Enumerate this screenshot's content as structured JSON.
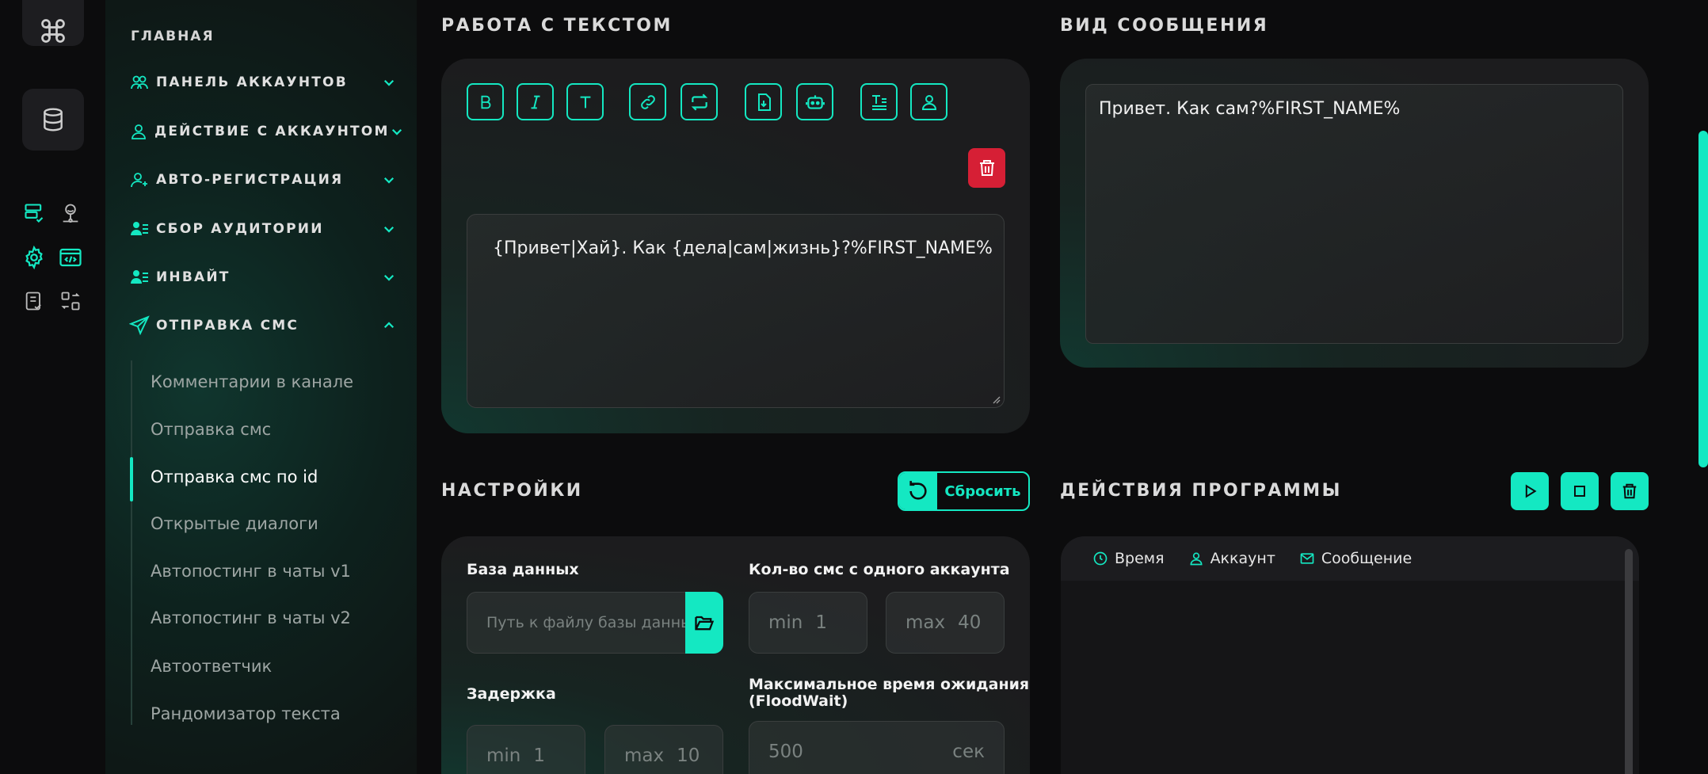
{
  "sidebar": {
    "home": "ГЛАВНАЯ",
    "sections": [
      {
        "label": "ПАНЕЛЬ АККАУНТОВ"
      },
      {
        "label": "ДЕЙСТВИЕ С АККАУНТОМ"
      },
      {
        "label": "АВТО-РЕГИСТРАЦИЯ"
      },
      {
        "label": "СБОР АУДИТОРИИ"
      },
      {
        "label": "ИНВАЙТ"
      },
      {
        "label": "ОТПРАВКА СМС"
      }
    ],
    "sub_items": [
      {
        "label": "Комментарии в канале"
      },
      {
        "label": "Отправка смс"
      },
      {
        "label": "Отправка смс по id"
      },
      {
        "label": "Открытые диалоги"
      },
      {
        "label": "Автопостинг в чаты v1"
      },
      {
        "label": "Автопостинг в чаты v2"
      },
      {
        "label": "Автоответчик"
      },
      {
        "label": "Рандомизатор текста"
      }
    ],
    "active_sub": "Отправка смс по id"
  },
  "text_work": {
    "title": "РАБОТА С ТЕКСТОМ",
    "toolbar": [
      "bold-icon",
      "italic-icon",
      "text-icon",
      "link-icon",
      "repeat-icon",
      "file-import-icon",
      "bot-icon",
      "text-format-icon",
      "user-icon"
    ],
    "content": "{Привет|Хай}. Как {дела|сам|жизнь}?%FIRST_NAME%"
  },
  "preview": {
    "title": "ВИД СООБЩЕНИЯ",
    "text": "Привет. Как сам?%FIRST_NAME%"
  },
  "settings": {
    "title": "НАСТРОЙКИ",
    "reset_label": "Сбросить",
    "database_label": "База данных",
    "database_placeholder": "Путь к файлу базы данных",
    "sms_per_account_label": "Кол-во смс с одного аккаунта",
    "sms_min_label": "min",
    "sms_min_value": "1",
    "sms_max_label": "max",
    "sms_max_value": "40",
    "delay_label": "Задержка",
    "delay_min_label": "min",
    "delay_min_value": "1",
    "delay_max_label": "max",
    "delay_max_value": "10",
    "floodwait_label_1": "Максимальное время ожидания",
    "floodwait_label_2": "(FloodWait)",
    "floodwait_value": "500",
    "floodwait_unit": "сек"
  },
  "program_actions": {
    "title": "ДЕЙСТВИЯ ПРОГРАММЫ",
    "columns": [
      "Время",
      "Аккаунт",
      "Сообщение"
    ]
  },
  "colors": {
    "accent": "#14e8c2",
    "danger": "#d61f35",
    "background": "#0c0c0d"
  }
}
